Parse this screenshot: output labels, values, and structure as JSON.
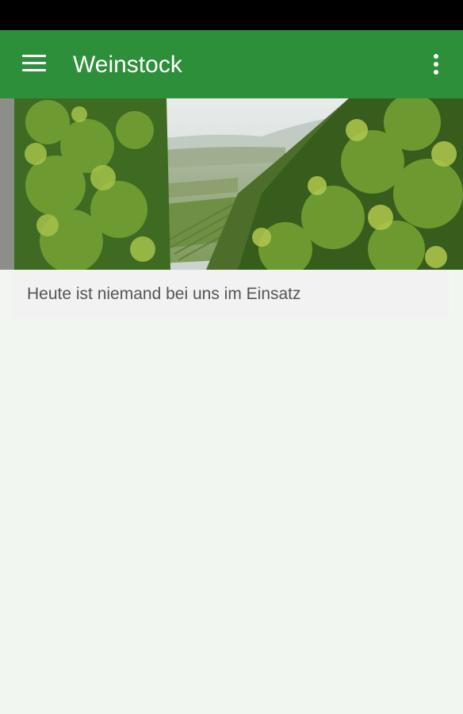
{
  "app_bar": {
    "title": "Weinstock",
    "background_color": "#2e8f3a",
    "menu_icon": "hamburger-menu-icon",
    "overflow_icon": "more-vertical-icon"
  },
  "hero_image": {
    "subject": "vineyard"
  },
  "info": {
    "message": "Heute ist niemand bei uns im Einsatz"
  },
  "colors": {
    "page_background": "#f1f7f0",
    "status_bar": "#000000"
  }
}
